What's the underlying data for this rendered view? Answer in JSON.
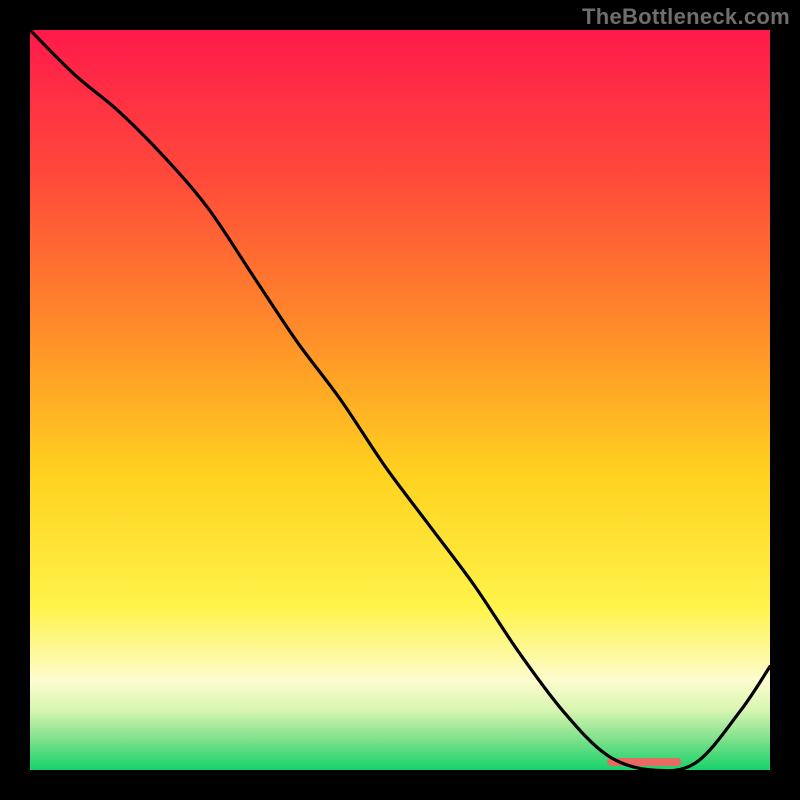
{
  "watermark": "TheBottleneck.com",
  "chart_data": {
    "type": "line",
    "title": "",
    "xlabel": "",
    "ylabel": "",
    "xlim": [
      0,
      100
    ],
    "ylim": [
      0,
      100
    ],
    "series": [
      {
        "name": "bottleneck-curve",
        "x": [
          0,
          6,
          12,
          18,
          24,
          30,
          36,
          42,
          48,
          54,
          60,
          66,
          72,
          78,
          84,
          90,
          96,
          100
        ],
        "y": [
          100,
          94,
          89,
          83,
          76,
          67,
          58,
          50,
          41,
          33,
          25,
          16,
          8,
          2,
          0,
          1,
          8,
          14
        ]
      }
    ],
    "optimum_band": {
      "x_start": 78,
      "x_end": 88,
      "color": "#e86a63"
    },
    "gradient_stops": [
      {
        "offset": 0.0,
        "color": "#ff1a4b"
      },
      {
        "offset": 0.2,
        "color": "#ff4a3a"
      },
      {
        "offset": 0.4,
        "color": "#ff8a2a"
      },
      {
        "offset": 0.6,
        "color": "#ffd21f"
      },
      {
        "offset": 0.78,
        "color": "#fff34a"
      },
      {
        "offset": 0.88,
        "color": "#fdfccf"
      },
      {
        "offset": 0.92,
        "color": "#d6f5b0"
      },
      {
        "offset": 0.96,
        "color": "#7be08a"
      },
      {
        "offset": 1.0,
        "color": "#15d36a"
      }
    ]
  }
}
